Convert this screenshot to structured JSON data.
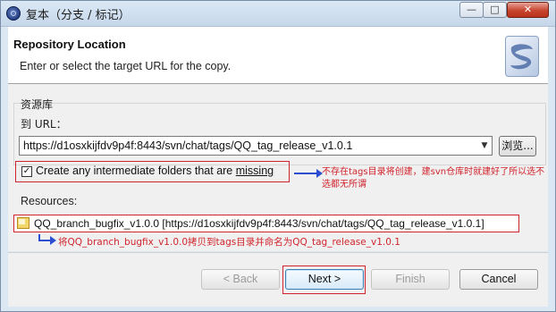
{
  "window": {
    "title": "复本（分支 / 标记）",
    "minimize_glyph": "—",
    "maximize_glyph": "□",
    "close_glyph": "✕"
  },
  "header": {
    "title": "Repository Location",
    "description": "Enter or select the target URL for the copy.",
    "banner_icon": "svn-wizard-banner-icon"
  },
  "repository_group": {
    "label": "资源库",
    "url_label": "到 URL：",
    "url_value": "https://d1osxkijfdv9p4f:8443/svn/chat/tags/QQ_tag_release_v1.0.1",
    "dropdown_icon": "chevron-down-icon",
    "browse_button": "浏览..."
  },
  "options": {
    "create_folders_checked": true,
    "create_folders_label_prefix": "Create any intermediate folders that are ",
    "create_folders_label_underlined": "missing",
    "annotation_create_folders": "不存在tags目录将创建，建svn仓库时就建好了所以选不选都无所谓"
  },
  "resources": {
    "label": "Resources:",
    "items": [
      {
        "text": "QQ_branch_bugfix_v1.0.0 [https://d1osxkijfdv9p4f:8443/svn/chat/tags/QQ_tag_release_v1.0.1]",
        "icon": "folder-icon"
      }
    ],
    "annotation": "将QQ_branch_bugfix_v1.0.0拷贝到tags目录并命名为QQ_tag_release_v1.0.1"
  },
  "footer": {
    "back": "< Back",
    "next": "Next >",
    "finish": "Finish",
    "cancel": "Cancel"
  },
  "colors": {
    "annotation_red": "#d0242c",
    "annotation_blue": "#2c4ed1",
    "window_bg": "#dbe7f3"
  }
}
